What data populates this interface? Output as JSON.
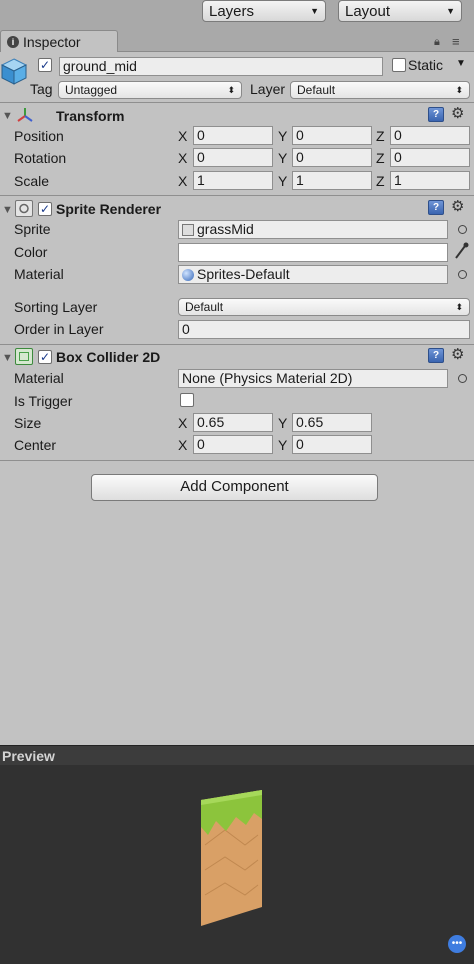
{
  "top_bar": {
    "layers_dropdown": "Layers",
    "layout_dropdown": "Layout"
  },
  "tab": {
    "label": "Inspector"
  },
  "object": {
    "name": "ground_mid",
    "active": true,
    "static_label": "Static",
    "static_checked": false,
    "tag_label": "Tag",
    "tag_value": "Untagged",
    "layer_label": "Layer",
    "layer_value": "Default"
  },
  "transform": {
    "title": "Transform",
    "rows": [
      {
        "label": "Position",
        "x": "0",
        "y": "0",
        "z": "0"
      },
      {
        "label": "Rotation",
        "x": "0",
        "y": "0",
        "z": "0"
      },
      {
        "label": "Scale",
        "x": "1",
        "y": "1",
        "z": "1"
      }
    ]
  },
  "sprite_renderer": {
    "title": "Sprite Renderer",
    "enabled": true,
    "sprite_label": "Sprite",
    "sprite_value": "grassMid",
    "color_label": "Color",
    "color_value": "#ffffff",
    "material_label": "Material",
    "material_value": "Sprites-Default",
    "sorting_layer_label": "Sorting Layer",
    "sorting_layer_value": "Default",
    "order_label": "Order in Layer",
    "order_value": "0"
  },
  "box_collider": {
    "title": "Box Collider 2D",
    "enabled": true,
    "material_label": "Material",
    "material_value": "None (Physics Material 2D)",
    "trigger_label": "Is Trigger",
    "trigger_checked": false,
    "size_label": "Size",
    "size_x": "0.65",
    "size_y": "0.65",
    "center_label": "Center",
    "center_x": "0",
    "center_y": "0"
  },
  "axes": {
    "x": "X",
    "y": "Y",
    "z": "Z"
  },
  "add_component_label": "Add Component",
  "preview": {
    "title": "Preview"
  },
  "colors": {
    "grass": "#8cc43c",
    "dirt": "#d9a066",
    "panel": "#c2c2c2",
    "preview_bg": "#313131"
  }
}
